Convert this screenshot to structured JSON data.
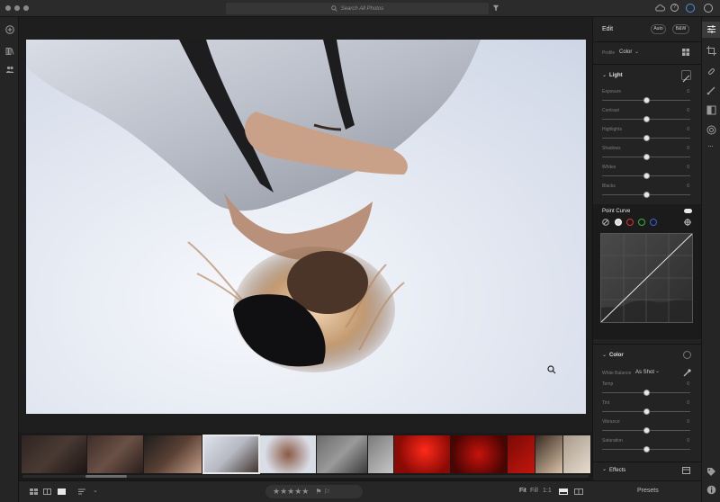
{
  "top_bar": {
    "search_placeholder": "Search All Photos",
    "icons": [
      "search-icon",
      "filter-icon",
      "cloud-icon",
      "help-icon",
      "sync-icon",
      "account-icon"
    ]
  },
  "left_rail": {
    "icons": [
      "add-photos-icon",
      "library-icon",
      "people-icon"
    ]
  },
  "edit_panel": {
    "title": "Edit",
    "auto_label": "Auto",
    "bw_label": "B&W",
    "profile_label": "Profile",
    "profile_value": "Color",
    "light": {
      "label": "Light",
      "sliders": [
        {
          "label": "Exposure",
          "value": "0",
          "level": 0.5
        },
        {
          "label": "Contrast",
          "value": "0",
          "level": 0.5
        },
        {
          "label": "Highlights",
          "value": "0",
          "level": 0.5
        },
        {
          "label": "Shadows",
          "value": "0",
          "level": 0.5
        },
        {
          "label": "Whites",
          "value": "0",
          "level": 0.5
        },
        {
          "label": "Blacks",
          "value": "0",
          "level": 0.5
        }
      ]
    },
    "point_curve": {
      "label": "Point Curve",
      "channels": [
        "parametric",
        "rgb",
        "red",
        "green",
        "blue"
      ]
    },
    "color": {
      "label": "Color",
      "white_balance_label": "White Balance",
      "white_balance_value": "As Shot",
      "sliders": [
        {
          "label": "Temp",
          "value": "0",
          "level": 0.5
        },
        {
          "label": "Tint",
          "value": "0",
          "level": 0.5
        },
        {
          "label": "Vibrance",
          "value": "0",
          "level": 0.5
        },
        {
          "label": "Saturation",
          "value": "0",
          "level": 0.5
        }
      ]
    },
    "effects_label": "Effects"
  },
  "bottom_bar": {
    "zoom_fit": "Fit",
    "zoom_fill": "Fill",
    "zoom_1to1": "1:1",
    "presets_label": "Presets",
    "stars": "★★★★★",
    "flags": "⚑ ⚐"
  },
  "filmstrip": {
    "selected_index": 3,
    "scroll_position": 0.12,
    "thumbs": [
      {
        "kind": "dark-room"
      },
      {
        "kind": "dark-group"
      },
      {
        "kind": "dark-portrait"
      },
      {
        "kind": "upside-down"
      },
      {
        "kind": "hair-sky"
      },
      {
        "kind": "couple-gray"
      },
      {
        "kind": "couple-light"
      },
      {
        "kind": "red-1"
      },
      {
        "kind": "red-2"
      },
      {
        "kind": "red-3"
      },
      {
        "kind": "warm-1"
      },
      {
        "kind": "warm-2"
      }
    ]
  },
  "colors": {
    "accent_blue": "#4a90e2",
    "panel_bg": "#232323",
    "photo_sky": "#e6eaf3"
  }
}
